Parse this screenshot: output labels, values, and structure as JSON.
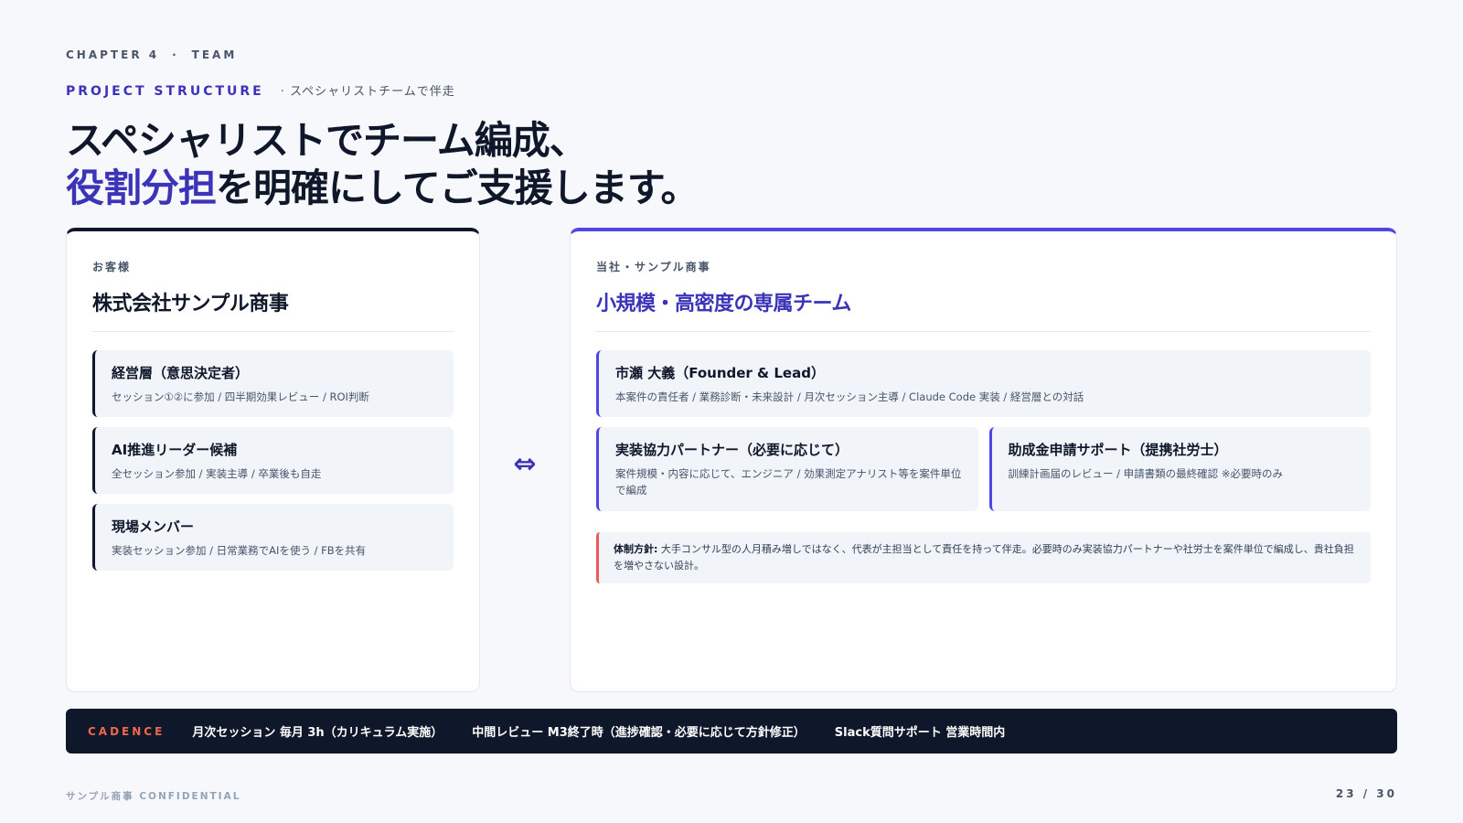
{
  "header": {
    "chapter": "CHAPTER 4",
    "chapter_sep": "·",
    "chapter_name": "TEAM",
    "section": "PROJECT STRUCTURE",
    "section_sub": "· スペシャリストチームで伴走",
    "title_line1": "スペシャリストでチーム編成、",
    "title_accent": "役割分担",
    "title_line2_rest": "を明確にしてご支援します。"
  },
  "client": {
    "label": "お客様",
    "title": "株式会社サンプル商事",
    "cards": [
      {
        "title": "経営層（意思決定者）",
        "desc": "セッション①②に参加 / 四半期効果レビュー / ROI判断"
      },
      {
        "title": "AI推進リーダー候補",
        "desc": "全セッション参加 / 実装主導 / 卒業後も自走"
      },
      {
        "title": "現場メンバー",
        "desc": "実装セッション参加 / 日常業務でAIを使う / FBを共有"
      }
    ]
  },
  "connector": "⇔",
  "vendor": {
    "label": "当社・サンプル商事",
    "title": "小規模・高密度の専属チーム",
    "lead": {
      "title": "市瀬 大義（Founder & Lead）",
      "desc": "本案件の責任者 / 業務診断・未来設計 / 月次セッション主導 / Claude Code 実装 / 経営層との対話"
    },
    "partners": [
      {
        "title": "実装協力パートナー（必要に応じて）",
        "desc": "案件規模・内容に応じて、エンジニア / 効果測定アナリスト等を案件単位で編成"
      },
      {
        "title": "助成金申請サポート（提携社労士）",
        "desc": "訓練計画届のレビュー / 申請書類の最終確認 ※必要時のみ"
      }
    ],
    "policy_label": "体制方針:",
    "policy_text": "大手コンサル型の人月積み増しではなく、代表が主担当として責任を持って伴走。必要時のみ実装協力パートナーや社労士を案件単位で編成し、貴社負担を増やさない設計。"
  },
  "cadence": {
    "label": "CADENCE",
    "items": [
      "月次セッション 毎月 3h（カリキュラム実施）",
      "中間レビュー M3終了時（進捗確認・必要に応じて方針修正）",
      "Slack質問サポート 営業時間内"
    ]
  },
  "footer": {
    "left": "サンプル商事 CONFIDENTIAL",
    "page": "23 / 30"
  }
}
